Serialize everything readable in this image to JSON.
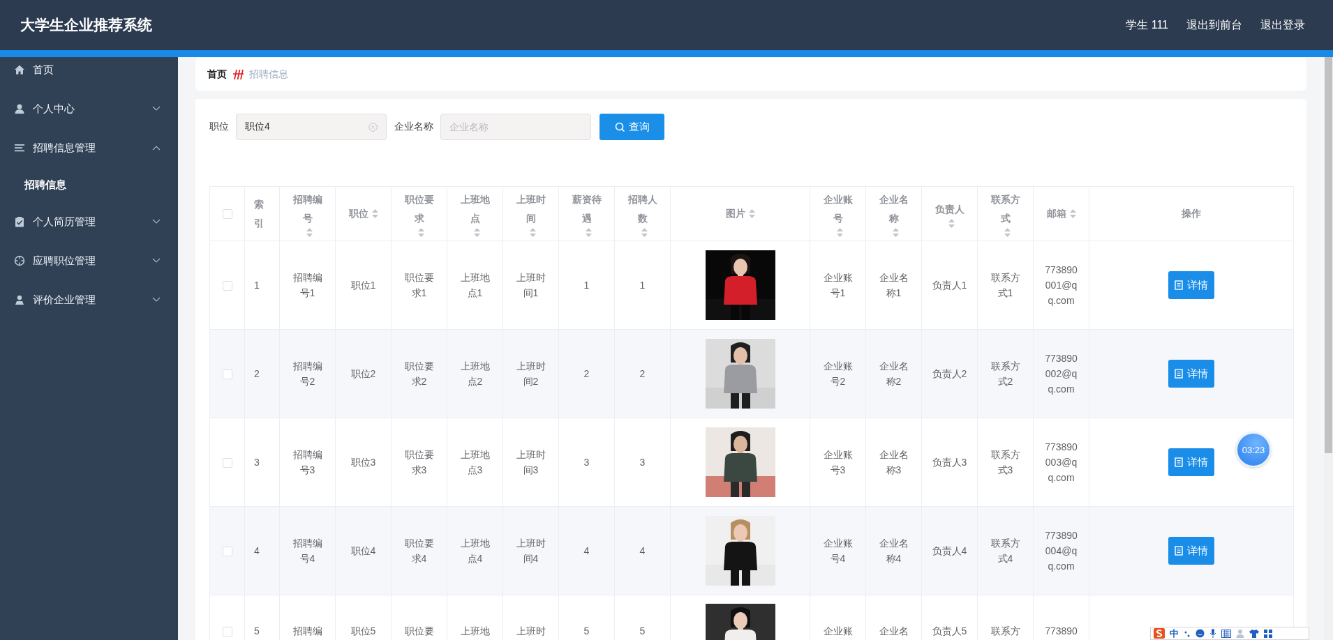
{
  "header": {
    "title": "大学生企业推荐系统",
    "user": "学生 111",
    "links": [
      "退出到前台",
      "退出登录"
    ]
  },
  "sidebar": {
    "items": [
      {
        "label": "首页",
        "kind": "link"
      },
      {
        "label": "个人中心",
        "kind": "group",
        "expanded": false
      },
      {
        "label": "招聘信息管理",
        "kind": "group",
        "expanded": true,
        "children": [
          {
            "label": "招聘信息",
            "selected": true
          }
        ]
      },
      {
        "label": "个人简历管理",
        "kind": "group",
        "expanded": false
      },
      {
        "label": "应聘职位管理",
        "kind": "group",
        "expanded": false
      },
      {
        "label": "评价企业管理",
        "kind": "group",
        "expanded": false
      }
    ]
  },
  "breadcrumb": {
    "home": "首页",
    "current": "招聘信息"
  },
  "search": {
    "fields": [
      {
        "label": "职位",
        "value": "职位4"
      },
      {
        "label": "企业名称",
        "placeholder": "企业名称"
      }
    ],
    "button": "查询"
  },
  "table": {
    "select_all_checked": false,
    "columns": [
      {
        "label": "索引",
        "kind": "text",
        "sortable": false
      },
      {
        "label": "招聘编号",
        "kind": "text",
        "sortable": true
      },
      {
        "label": "职位",
        "kind": "text",
        "sortable": true
      },
      {
        "label": "职位要求",
        "kind": "text",
        "sortable": true
      },
      {
        "label": "上班地点",
        "kind": "text",
        "sortable": true
      },
      {
        "label": "上班时间",
        "kind": "text",
        "sortable": true
      },
      {
        "label": "薪资待遇",
        "kind": "text",
        "sortable": true
      },
      {
        "label": "招聘人数",
        "kind": "text",
        "sortable": true
      },
      {
        "label": "图片",
        "kind": "picture",
        "sortable": true
      },
      {
        "label": "企业账号",
        "kind": "text",
        "sortable": true
      },
      {
        "label": "企业名称",
        "kind": "text",
        "sortable": true
      },
      {
        "label": "负责人",
        "kind": "text",
        "sortable": true
      },
      {
        "label": "联系方式",
        "kind": "text",
        "sortable": true
      },
      {
        "label": "邮箱",
        "kind": "text",
        "sortable": true
      },
      {
        "label": "操作",
        "kind": "action",
        "sortable": false
      }
    ],
    "rows": [
      {
        "checked": false,
        "cells": [
          "1",
          "招聘编号1",
          "职位1",
          "职位要求1",
          "上班地点1",
          "上班时间1",
          "1",
          "1",
          {
            "kind": "picture"
          },
          "企业账号1",
          "企业名称1",
          "负责人1",
          "联系方式1",
          "773890001@qq.com",
          "详情"
        ]
      },
      {
        "checked": false,
        "cells": [
          "2",
          "招聘编号2",
          "职位2",
          "职位要求2",
          "上班地点2",
          "上班时间2",
          "2",
          "2",
          {
            "kind": "picture"
          },
          "企业账号2",
          "企业名称2",
          "负责人2",
          "联系方式2",
          "773890002@qq.com",
          "详情"
        ]
      },
      {
        "checked": false,
        "cells": [
          "3",
          "招聘编号3",
          "职位3",
          "职位要求3",
          "上班地点3",
          "上班时间3",
          "3",
          "3",
          {
            "kind": "picture"
          },
          "企业账号3",
          "企业名称3",
          "负责人3",
          "联系方式3",
          "773890003@qq.com",
          "详情"
        ]
      },
      {
        "checked": false,
        "cells": [
          "4",
          "招聘编号4",
          "职位4",
          "职位要求4",
          "上班地点4",
          "上班时间4",
          "4",
          "4",
          {
            "kind": "picture"
          },
          "企业账号4",
          "企业名称4",
          "负责人4",
          "联系方式4",
          "773890004@qq.com",
          "详情"
        ]
      },
      {
        "checked": false,
        "cells": [
          "5",
          "招聘编",
          "职位5",
          "职位要",
          "上班地",
          "上班时",
          "5",
          "5",
          {
            "kind": "picture"
          },
          "企业账",
          "企业名",
          "负责人5",
          "联系方",
          "773890",
          ""
        ]
      }
    ]
  },
  "timer": {
    "text": "03:23"
  },
  "ime_toolbar": {
    "mode": "中"
  }
}
